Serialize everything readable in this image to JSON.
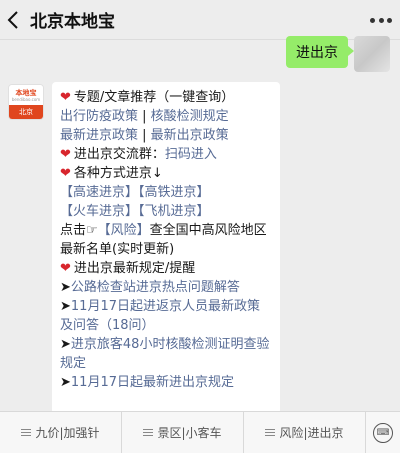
{
  "header": {
    "title": "北京本地宝",
    "back_icon": "chevron-left-icon",
    "more_icon": "more-dots-icon"
  },
  "outgoing": {
    "text": "进出京"
  },
  "bot_avatar": {
    "logo": "本地宝",
    "sub": "bendibao.com",
    "city": "北京"
  },
  "message": {
    "l1": "专题/文章推荐（一键查询）",
    "l2a": "出行防疫政策",
    "l2sep": " | ",
    "l2b": "核酸检测规定",
    "l3a": "最新进京政策",
    "l3sep": " | ",
    "l3b": "最新出京政策",
    "l4a": "进出京交流群：",
    "l4b": "扫码进入",
    "l5": "各种方式进京↓",
    "l6a": "【高速进京】",
    "l6b": "【高铁进京】",
    "l7a": "【火车进京】",
    "l7b": "【飞机进京】",
    "l8a": "点击☞",
    "l8b": "【风险】",
    "l8c": "查全国中高风险地区",
    "l9": "最新名单(实时更新)",
    "l10": "进出京最新规定/提醒",
    "l11a": "➤",
    "l11b": "公路检查站进京热点问题解答",
    "l12a": "➤",
    "l12b": "11月17日起进返京人员最新政策及问答（18问）",
    "l13a": "➤",
    "l13b": "进京旅客48小时核酸检测证明查验规定",
    "l14a": "➤",
    "l14b": "11月17日起最新进出京规定"
  },
  "menu": {
    "items": [
      "九价|加强针",
      "景区|小客车",
      "风险|进出京"
    ],
    "keyboard_icon": "keyboard-icon"
  },
  "colors": {
    "link": "#576b95",
    "bubble_out": "#95ec69",
    "heart": "#d8262d",
    "brand": "#e0461e"
  }
}
